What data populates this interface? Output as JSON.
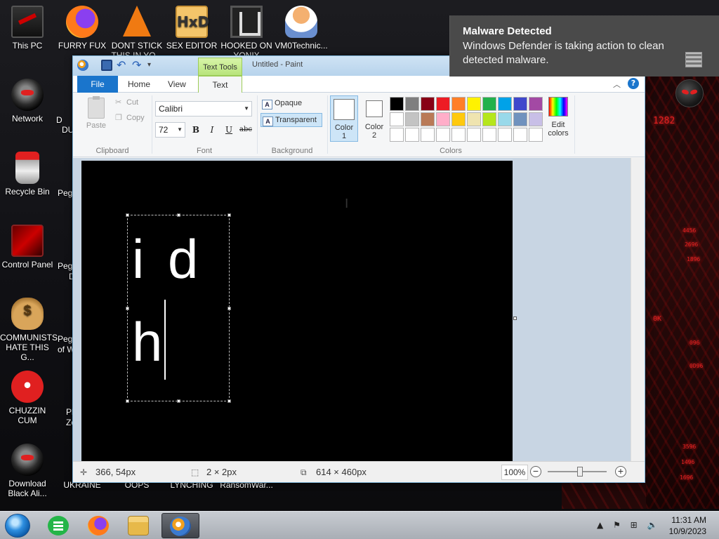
{
  "desktop": {
    "icons": [
      {
        "label": "This PC",
        "icon": "monitor-icon"
      },
      {
        "label": "FURRY FUX",
        "icon": "firefox-icon"
      },
      {
        "label": "DONT STICK THIS IN YO...",
        "icon": "vlc-cone-icon"
      },
      {
        "label": "SEX EDITOR",
        "icon": "hxd-editor-icon",
        "glyph": "HxD"
      },
      {
        "label": "HOOKED ON YONIX",
        "icon": "hooked-game-icon"
      },
      {
        "label": "VM0Technic...",
        "icon": "person-icon"
      },
      {
        "label": "Network",
        "icon": "alien-network-icon"
      },
      {
        "label": "Recycle Bin",
        "icon": "recycle-bin-icon"
      },
      {
        "label": "Control Panel",
        "icon": "control-panel-icon"
      },
      {
        "label": "COMMUNISTS HATE THIS G...",
        "icon": "money-bag-icon"
      },
      {
        "label": "CHUZZIN CUM",
        "icon": "red-chuzzle-icon"
      },
      {
        "label": "Download Black Ali...",
        "icon": "alien-download-icon"
      }
    ],
    "partial_labels": [
      {
        "label": "D",
        "id": "d1"
      },
      {
        "label": "DUM",
        "id": "d2"
      },
      {
        "label": "Pegg",
        "id": "p1"
      },
      {
        "label": "Pegg",
        "id": "p2"
      },
      {
        "label": "D",
        "id": "p2b"
      },
      {
        "label": "Pegg",
        "id": "p3"
      },
      {
        "label": "of W",
        "id": "p3b"
      },
      {
        "label": "Pla",
        "id": "p4"
      },
      {
        "label": "Zo",
        "id": "p4b"
      },
      {
        "label": "UKRAINE",
        "id": "u1"
      },
      {
        "label": "OOPS",
        "id": "u2"
      },
      {
        "label": "LYNCHING",
        "id": "u3"
      },
      {
        "label": "RansomWar...",
        "id": "u4"
      }
    ],
    "wallpaper_numbers": [
      "1282",
      "4456",
      "2696",
      "1896",
      "0K",
      "096",
      "0D96",
      "3596",
      "1496",
      "1696",
      "1496"
    ],
    "accent_red": "#e02020"
  },
  "paint": {
    "window_title": "Untitled - Paint",
    "context_tab": "Text Tools",
    "tabs": {
      "file": "File",
      "home": "Home",
      "view": "View",
      "text": "Text"
    },
    "help": "?",
    "clipboard": {
      "paste": "Paste",
      "cut": "Cut",
      "copy": "Copy",
      "group": "Clipboard"
    },
    "font": {
      "family": "Calibri",
      "size": "72",
      "bold": "B",
      "italic": "I",
      "underline": "U",
      "strike": "abc",
      "group": "Font"
    },
    "background": {
      "opaque": "Opaque",
      "transparent": "Transparent",
      "group": "Background",
      "selected": "Transparent"
    },
    "colors": {
      "color1": "Color 1",
      "color1_line1": "Color",
      "color1_line2": "1",
      "color2_line1": "Color",
      "color2_line2": "2",
      "edit_line1": "Edit",
      "edit_line2": "colors",
      "group": "Colors",
      "color1_value": "#ffffff",
      "color2_value": "#ffffff",
      "palette_row1": [
        "#000000",
        "#7f7f7f",
        "#880015",
        "#ed1c24",
        "#ff7f27",
        "#fff200",
        "#22b14c",
        "#00a2e8",
        "#3f48cc",
        "#a349a4"
      ],
      "palette_row2": [
        "#ffffff",
        "#c3c3c3",
        "#b97a57",
        "#ffaec9",
        "#ffc90e",
        "#efe4b0",
        "#b5e61d",
        "#99d9ea",
        "#7092be",
        "#c8bfe7"
      ],
      "palette_row3": [
        "#ffffff",
        "#ffffff",
        "#ffffff",
        "#ffffff",
        "#ffffff",
        "#ffffff",
        "#ffffff",
        "#ffffff",
        "#ffffff",
        "#ffffff"
      ]
    },
    "canvas_text": {
      "line1": "i d",
      "line2": "h"
    },
    "status": {
      "position": "366, 54px",
      "selection": "2 × 2px",
      "size": "614 × 460px",
      "zoom": "100%",
      "zoom_level": 0.55
    }
  },
  "toast": {
    "title": "Malware Detected",
    "body": "Windows Defender is taking action to clean detected malware."
  },
  "taskbar": {
    "apps": [
      "notes-app",
      "firefox",
      "file-explorer",
      "paint"
    ],
    "time": "11:31 AM",
    "date": "10/9/2023"
  }
}
